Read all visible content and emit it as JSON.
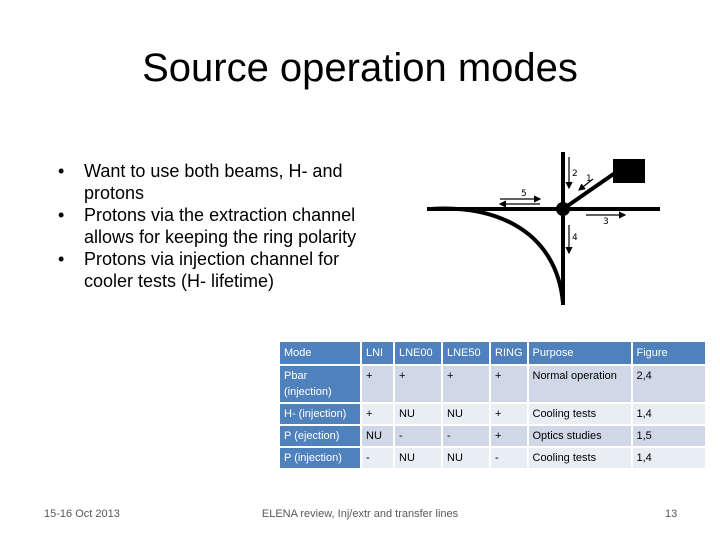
{
  "slide": {
    "title": "Source operation modes",
    "bullets": [
      "Want to use both beams, H- and protons",
      "Protons via the extraction channel allows for keeping the ring polarity",
      "Protons via injection channel for cooler tests (H- lifetime)"
    ],
    "bullet_glyph": "•",
    "diagram": {
      "labels": [
        "1",
        "2",
        "3",
        "4",
        "5"
      ],
      "icon": "beamline-junction-diagram"
    },
    "table": {
      "headers": [
        "Mode",
        "LNI",
        "LNE00",
        "LNE50",
        "RING",
        "Purpose",
        "Figure"
      ],
      "rows": [
        [
          "Pbar (injection)",
          "+",
          "+",
          "+",
          "+",
          "Normal operation",
          "2,4"
        ],
        [
          "H- (injection)",
          "+",
          "NU",
          "NU",
          "+",
          "Cooling tests",
          "1,4"
        ],
        [
          "P (ejection)",
          "NU",
          "-",
          "-",
          "+",
          "Optics studies",
          "1,5"
        ],
        [
          "P (injection)",
          "-",
          "NU",
          "NU",
          "-",
          "Cooling tests",
          "1,4"
        ]
      ],
      "colors": {
        "header": "#4f81bd",
        "row_dark": "#d0d8e8",
        "row_light": "#e9edf4"
      }
    },
    "footer": {
      "date": "15-16 Oct 2013",
      "center": "ELENA review, Inj/extr and transfer lines",
      "page": "13"
    }
  }
}
